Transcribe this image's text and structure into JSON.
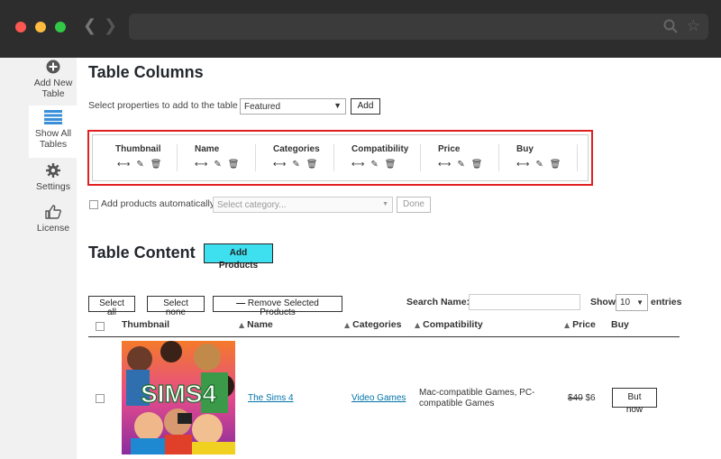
{
  "sidebar": {
    "items": [
      {
        "icon": "plus-circle-icon",
        "label": "Add New Table"
      },
      {
        "icon": "list-icon",
        "label": "Show All Tables"
      },
      {
        "icon": "gear-icon",
        "label": "Settings"
      },
      {
        "icon": "thumbs-up-icon",
        "label": "License"
      }
    ]
  },
  "columns_section": {
    "title": "Table Columns",
    "select_prompt": "Select properties to add to the table",
    "select_value": "Featured",
    "add_label": "Add",
    "columns": [
      {
        "name": "Thumbnail"
      },
      {
        "name": "Name"
      },
      {
        "name": "Categories"
      },
      {
        "name": "Compatibility"
      },
      {
        "name": "Price"
      },
      {
        "name": "Buy"
      }
    ],
    "auto_label": "Add products automatically",
    "category_placeholder": "Select category...",
    "done_label": "Done"
  },
  "content_section": {
    "title": "Table Content",
    "add_products_label": "Add Products",
    "select_all_label": "Select all",
    "select_none_label": "Select none",
    "remove_label": "Remove Selected Products",
    "search_label": "Search Name:",
    "search_value": "",
    "show_label": "Show",
    "show_value": "10",
    "entries_label": "entries",
    "headers": {
      "thumbnail": "Thumbnail",
      "name": "Name",
      "categories": "Categories",
      "compatibility": "Compatibility",
      "price": "Price",
      "buy": "Buy"
    },
    "rows": [
      {
        "thumb_text": "SIMS4",
        "name": "The Sims 4",
        "category": "Video Games",
        "compatibility": "Mac-compatible Games, PC-compatible Games",
        "old_price": "$40",
        "price": "$6",
        "buy_label": "But now"
      }
    ]
  },
  "colors": {
    "highlight_border": "#e02020",
    "add_products_bg": "#3ee0f0",
    "link": "#0073aa",
    "sidebar_icon": "#3a8fd8"
  }
}
